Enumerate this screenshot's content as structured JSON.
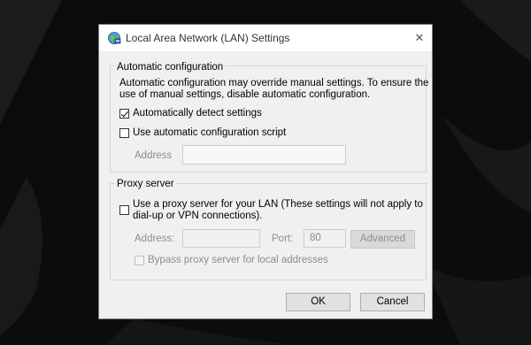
{
  "window": {
    "title": "Local Area Network (LAN) Settings",
    "close_glyph": "✕"
  },
  "auto_config": {
    "legend": "Automatic configuration",
    "description_line1": "Automatic configuration may override manual settings.  To ensure the",
    "description_line2": "use of manual settings, disable automatic configuration.",
    "detect_label": "Automatically detect settings",
    "detect_checked": true,
    "script_label": "Use automatic configuration script",
    "script_checked": false,
    "address_label": "Address",
    "address_value": ""
  },
  "proxy": {
    "legend": "Proxy server",
    "use_proxy_line1": "Use a proxy server for your LAN (These settings will not apply to",
    "use_proxy_line2": "dial-up or VPN connections).",
    "use_proxy_checked": false,
    "address_label": "Address:",
    "address_value": "",
    "port_label": "Port:",
    "port_value": "80",
    "advanced_label": "Advanced",
    "bypass_label": "Bypass proxy server for local addresses",
    "bypass_checked": false
  },
  "buttons": {
    "ok": "OK",
    "cancel": "Cancel"
  },
  "icons": {
    "title_icon": "network-globe-icon",
    "close": "close-icon"
  },
  "colors": {
    "dialog_bg": "#f0f0f0",
    "titlebar_bg": "#ffffff",
    "desktop_bg": "#0c0c0c"
  }
}
